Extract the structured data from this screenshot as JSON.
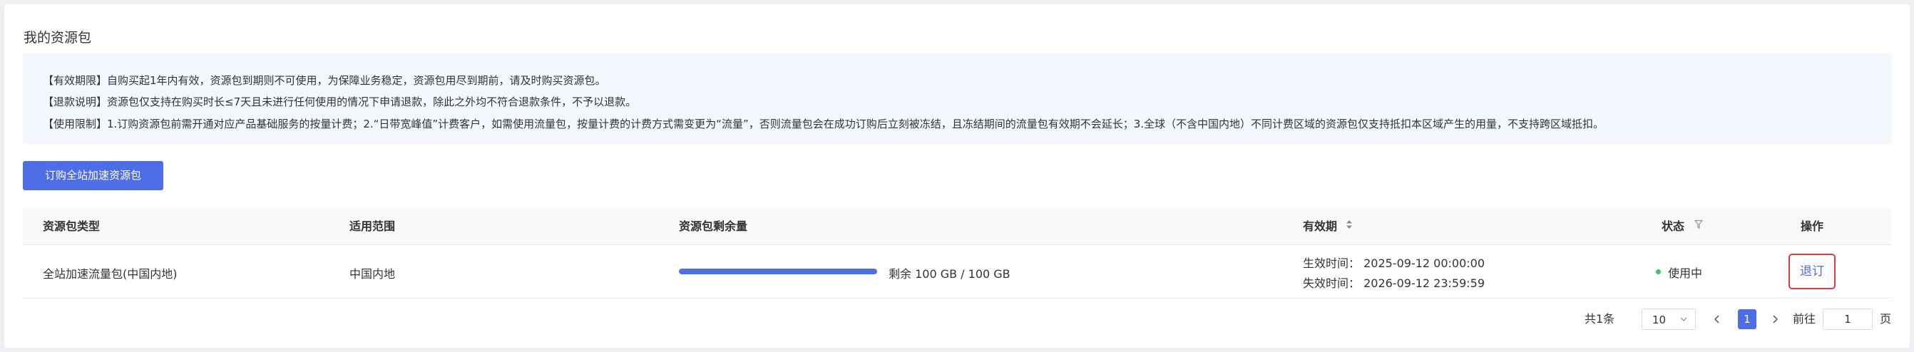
{
  "page": {
    "title": "我的资源包"
  },
  "notice": {
    "line1": "【有效期限】自购买起1年内有效，资源包到期则不可使用，为保障业务稳定，资源包用尽到期前，请及时购买资源包。",
    "line2": "【退款说明】资源包仅支持在购买时长≤7天且未进行任何使用的情况下申请退款，除此之外均不符合退款条件，不予以退款。",
    "line3": "【使用限制】1.订购资源包前需开通对应产品基础服务的按量计费；2.“日带宽峰值”计费客户，如需使用流量包，按量计费的计费方式需变更为“流量”，否则流量包会在成功订购后立刻被冻结，且冻结期间的流量包有效期不会延长；3.全球（不含中国内地）不同计费区域的资源包仅支持抵扣本区域产生的用量，不支持跨区域抵扣。"
  },
  "actions": {
    "buy_label": "订购全站加速资源包"
  },
  "table": {
    "headers": {
      "type": "资源包类型",
      "scope": "适用范围",
      "remaining": "资源包剩余量",
      "validity": "有效期",
      "status": "状态",
      "operation": "操作"
    },
    "rows": [
      {
        "type": "全站加速流量包(中国内地)",
        "scope": "中国内地",
        "remaining_fraction": 1.0,
        "remaining_text": "剩余 100 GB / 100 GB",
        "effective": "生效时间：  2025-09-12 00:00:00",
        "expire": "失效时间：  2026-09-12 23:59:59",
        "status": "使用中",
        "status_color": "#3cc46a",
        "operation": "退订"
      }
    ]
  },
  "pagination": {
    "total_text": "共1条",
    "page_size": "10",
    "current_page": "1",
    "goto_label": "前往",
    "goto_value": "1",
    "page_unit": "页"
  },
  "colors": {
    "accent": "#4e6ee8",
    "highlight_border": "#e0393e"
  },
  "icons": {
    "sort": "sort-icon",
    "filter": "filter-icon",
    "prev": "chevron-left-icon",
    "next": "chevron-right-icon",
    "dropdown": "chevron-down-icon"
  }
}
